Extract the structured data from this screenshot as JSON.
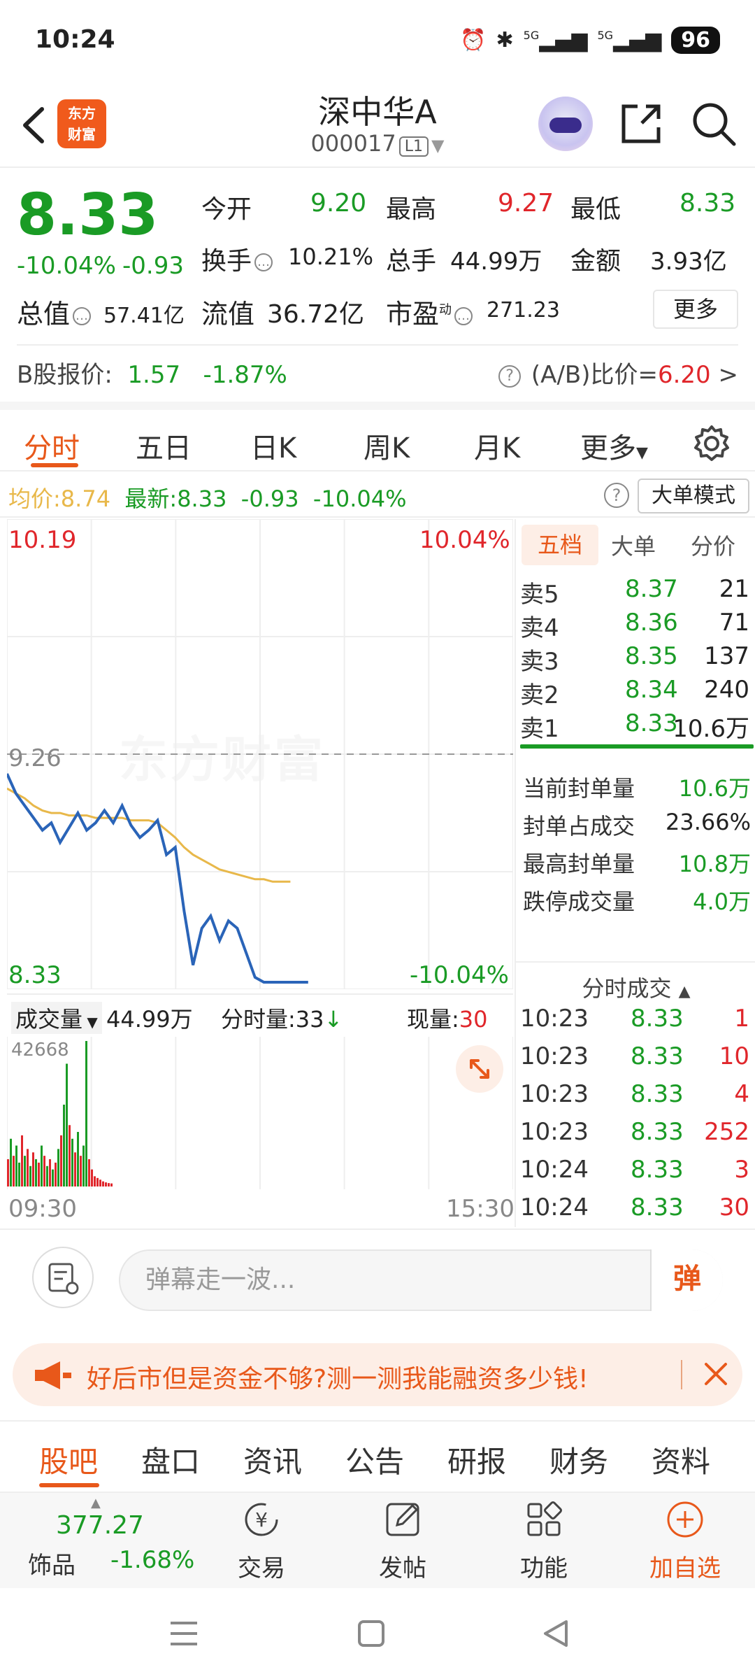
{
  "status_bar": {
    "time": "10:24",
    "signal1": "5G",
    "signal2": "5G",
    "battery": "96"
  },
  "header": {
    "logo_line1": "东方",
    "logo_line2": "财富",
    "stock_name": "深中华A",
    "stock_code": "000017",
    "level_tag": "L1"
  },
  "quote": {
    "price": "8.33",
    "change_pct": "-10.04%",
    "change_amt": "-0.93",
    "open_label": "今开",
    "open_value": "9.20",
    "high_label": "最高",
    "high_value": "9.27",
    "low_label": "最低",
    "low_value": "8.33",
    "turnover_label": "换手",
    "turnover_value": "10.21%",
    "volume_label": "总手",
    "volume_value": "44.99万",
    "amount_label": "金额",
    "amount_value": "3.93亿",
    "mktcap_label": "总值",
    "mktcap_value": "57.41亿",
    "float_label": "流值",
    "float_value": "36.72亿",
    "pe_label": "市盈",
    "pe_sup": "动",
    "pe_value": "271.23",
    "more_label": "更多",
    "b_label": "B股报价:",
    "b_price": "1.57",
    "b_change": "-1.87%",
    "ab_label": "(A/B)比价=",
    "ab_value": "6.20",
    "ab_arrow": ">"
  },
  "chart_tabs": [
    {
      "label": "分时",
      "active": true
    },
    {
      "label": "五日"
    },
    {
      "label": "日K"
    },
    {
      "label": "周K"
    },
    {
      "label": "月K"
    },
    {
      "label": "更多"
    }
  ],
  "avg_info": {
    "avg_label": "均价:",
    "avg_value": "8.74",
    "latest_label": "最新:",
    "latest_value": "8.33",
    "latest_chg": "-0.93",
    "latest_pct": "-10.04%",
    "help": "?",
    "bigorder_mode": "大单模式"
  },
  "chart": {
    "price_high": "10.19",
    "pct_high": "10.04%",
    "prev_close_label": "9.26",
    "price_low": "8.33",
    "pct_low": "-10.04%",
    "watermark": "东方财富",
    "time_start": "09:30",
    "time_end": "15:30"
  },
  "chart_data": {
    "type": "line",
    "ylim": [
      8.33,
      10.19
    ],
    "prev_close": 9.26,
    "x_range_minutes": 240,
    "series": [
      {
        "values": [
          9.18,
          9.1,
          9.05,
          9.0,
          8.95,
          8.98,
          8.9,
          8.96,
          9.02,
          8.95,
          8.98,
          9.03,
          8.98,
          9.05,
          8.97,
          8.92,
          8.95,
          8.99,
          8.85,
          8.88,
          8.62,
          8.4,
          8.55,
          8.6,
          8.5,
          8.58,
          8.55,
          8.45,
          8.35,
          8.33,
          8.33,
          8.33,
          8.33,
          8.33,
          8.33
        ]
      },
      {
        "values": [
          9.12,
          9.1,
          9.08,
          9.05,
          9.03,
          9.02,
          9.02,
          9.01,
          9.01,
          9.01,
          9.0,
          9.0,
          9.0,
          9.0,
          8.99,
          8.99,
          8.99,
          8.98,
          8.95,
          8.92,
          8.88,
          8.85,
          8.83,
          8.81,
          8.79,
          8.78,
          8.77,
          8.76,
          8.75,
          8.75,
          8.74,
          8.74,
          8.74,
          8.74,
          8.74
        ]
      }
    ],
    "volume": {
      "max_label": "42668",
      "values": [
        8000,
        14000,
        9000,
        12000,
        7000,
        15000,
        9000,
        11000,
        6000,
        10000,
        8000,
        7000,
        12000,
        9000,
        6000,
        8000,
        5000,
        7000,
        11000,
        15000,
        24000,
        36000,
        18000,
        14000,
        10000,
        16000,
        9000,
        12000,
        42668,
        8000,
        5000,
        3000,
        2500,
        2000,
        1500,
        1200,
        1000,
        900
      ],
      "colors": [
        "r",
        "g",
        "r",
        "g",
        "g",
        "r",
        "g",
        "r",
        "g",
        "r",
        "g",
        "r",
        "g",
        "r",
        "g",
        "r",
        "g",
        "r",
        "g",
        "r",
        "g",
        "g",
        "r",
        "g",
        "r",
        "g",
        "r",
        "g",
        "g",
        "r",
        "r",
        "r",
        "r",
        "r",
        "r",
        "r",
        "r",
        "r"
      ]
    }
  },
  "volume_bar": {
    "select_label": "成交量",
    "total": "44.99万",
    "minute_label": "分时量:",
    "minute_value": "33",
    "now_label": "现量:",
    "now_value": "30"
  },
  "right_panel": {
    "tabs": [
      "五档",
      "大单",
      "分价"
    ],
    "asks": [
      {
        "label": "卖5",
        "price": "8.37",
        "vol": "21"
      },
      {
        "label": "卖4",
        "price": "8.36",
        "vol": "71"
      },
      {
        "label": "卖3",
        "price": "8.35",
        "vol": "137"
      },
      {
        "label": "卖2",
        "price": "8.34",
        "vol": "240"
      },
      {
        "label": "卖1",
        "price": "8.33",
        "vol": "10.6万"
      }
    ],
    "seal": [
      {
        "label": "当前封单量",
        "value": "10.6万"
      },
      {
        "label": "封单占成交",
        "value": "23.66%"
      },
      {
        "label": "最高封单量",
        "value": "10.8万"
      },
      {
        "label": "跌停成交量",
        "value": "4.0万"
      }
    ],
    "ticks_header": "分时成交",
    "ticks": [
      {
        "time": "10:23",
        "price": "8.33",
        "vol": "1"
      },
      {
        "time": "10:23",
        "price": "8.33",
        "vol": "10"
      },
      {
        "time": "10:23",
        "price": "8.33",
        "vol": "4"
      },
      {
        "time": "10:23",
        "price": "8.33",
        "vol": "252"
      },
      {
        "time": "10:24",
        "price": "8.33",
        "vol": "3"
      },
      {
        "time": "10:24",
        "price": "8.33",
        "vol": "30"
      }
    ]
  },
  "comment_bar": {
    "placeholder": "弹幕走一波...",
    "danmu_btn": "弹"
  },
  "ad": {
    "text": "好后市但是资金不够?测一测我能融资多少钱!"
  },
  "bottom_tabs": [
    "股吧",
    "盘口",
    "资讯",
    "公告",
    "研报",
    "财务",
    "资料"
  ],
  "action_bar": {
    "index_value": "377.27",
    "index_name": "饰品",
    "index_change": "-1.68%",
    "actions": [
      "交易",
      "发帖",
      "功能",
      "加自选"
    ]
  },
  "colors": {
    "up": "#e0262b",
    "down": "#1a9b25",
    "accent": "#e8581a",
    "price_line": "#2a64b8",
    "avg_line": "#e8b84a"
  }
}
